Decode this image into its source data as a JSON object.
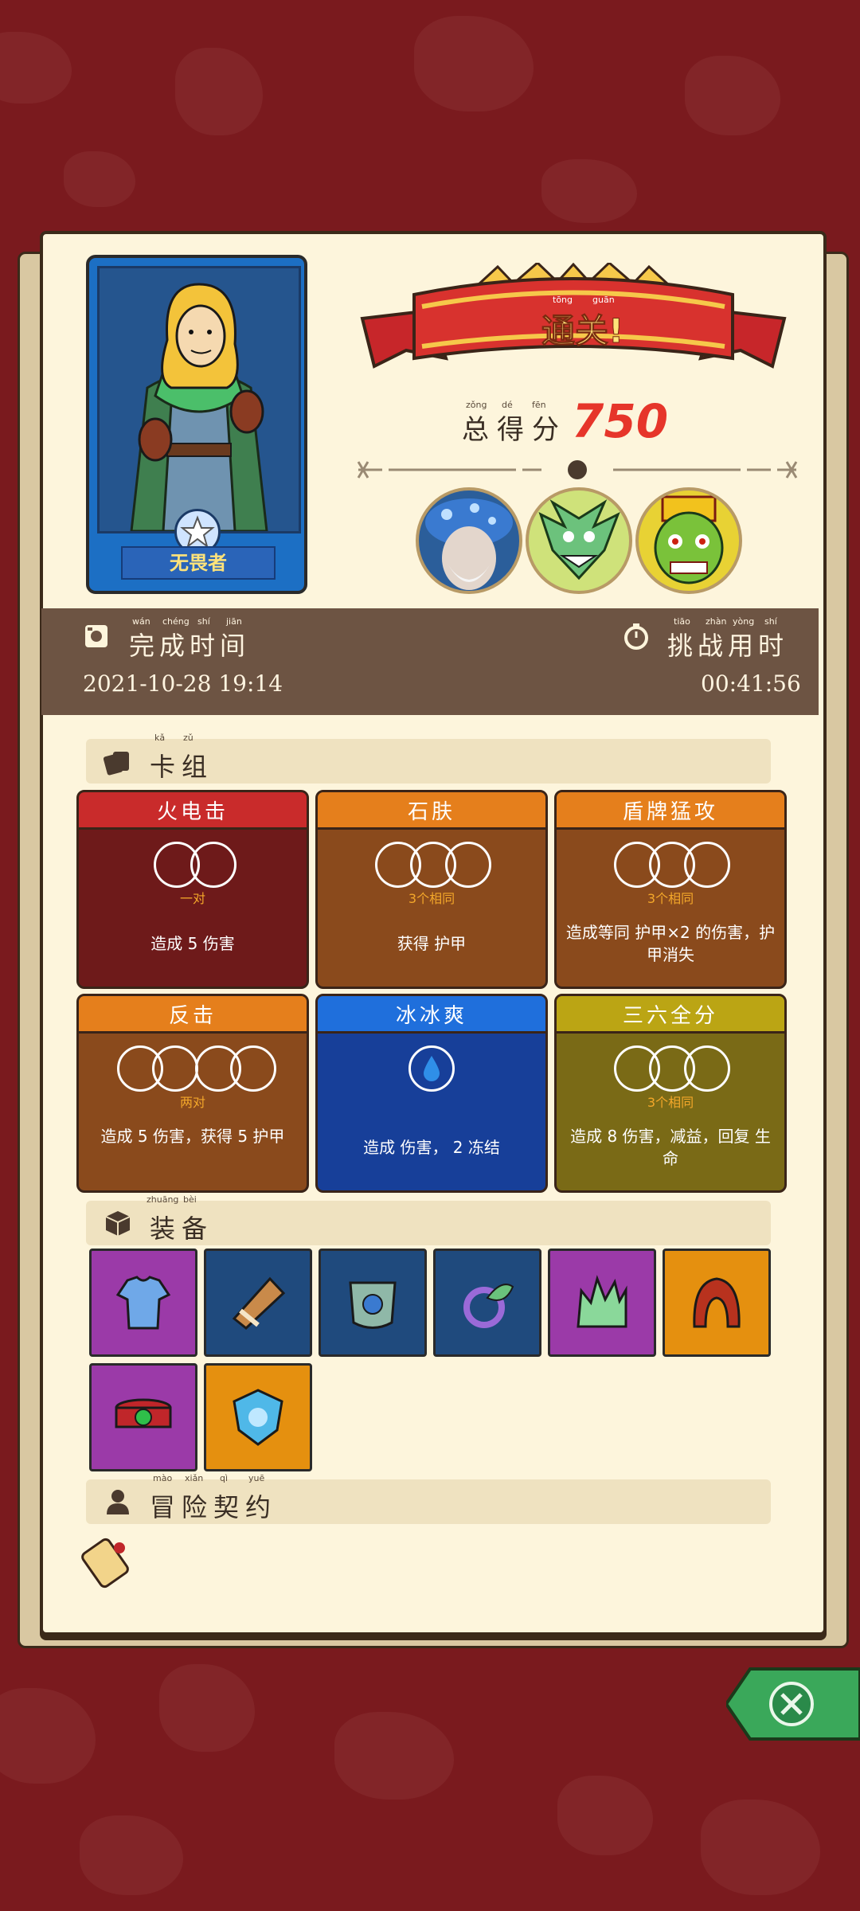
{
  "result": {
    "banner_text": "通关!",
    "banner_pinyin": [
      "tōng",
      "guān"
    ],
    "score_label": "总得分",
    "score_pinyin": [
      "zǒng",
      "dé",
      "fēn"
    ],
    "score_value": "750"
  },
  "hero": {
    "name": "无畏者"
  },
  "bosses": [
    {
      "name": "mushroom-sage-portrait"
    },
    {
      "name": "goblin-shaman-portrait"
    },
    {
      "name": "masked-warrior-portrait"
    }
  ],
  "time": {
    "finish_label": "完成时间",
    "finish_pinyin": [
      "wán",
      "chéng",
      "shí",
      "jiān"
    ],
    "finish_value": "2021-10-28 19:14",
    "challenge_label": "挑战用时",
    "challenge_pinyin": [
      "tiāo",
      "zhàn",
      "yòng",
      "shí"
    ],
    "challenge_value": "00:41:56"
  },
  "sections": {
    "deck": {
      "title": "卡组",
      "pinyin": [
        "kǎ",
        "zǔ"
      ]
    },
    "equipment": {
      "title": "装备",
      "pinyin": [
        "zhuāng",
        "bèi"
      ]
    },
    "contract": {
      "title": "冒险契约",
      "pinyin": [
        "mào",
        "xiǎn",
        "qì",
        "yuē"
      ]
    }
  },
  "cards": [
    {
      "title": "火电击",
      "sub": "一对",
      "desc": "造成 5 伤害",
      "color": "#c92b2b",
      "body": "#6e1a1a",
      "slots": 2
    },
    {
      "title": "石肤",
      "sub": "3个相同",
      "desc": "获得 护甲",
      "color": "#e57f1c",
      "body": "#8a4a1c",
      "slots": 3
    },
    {
      "title": "盾牌猛攻",
      "sub": "3个相同",
      "desc": "造成等同 护甲×2 的伤害，护甲消失",
      "color": "#e57f1c",
      "body": "#8a4a1c",
      "slots": 3
    },
    {
      "title": "反击",
      "sub": "两对",
      "desc": "造成 5 伤害，获得 5 护甲",
      "color": "#e57f1c",
      "body": "#8a4a1c",
      "slots": 4
    },
    {
      "title": "冰冰爽",
      "sub": "",
      "desc": "造成 伤害， 2 冻结",
      "color": "#1f6fdc",
      "body": "#173f99",
      "slots": 1
    },
    {
      "title": "三六全分",
      "sub": "3个相同",
      "desc": "造成 8 伤害，减益，回复 生命",
      "color": "#bba514",
      "body": "#7a6a16",
      "slots": 3
    }
  ],
  "equipment": [
    {
      "icon": "tunic-icon",
      "bg": "#9b3aa8"
    },
    {
      "icon": "horn-icon",
      "bg": "#1f4a7d"
    },
    {
      "icon": "chest-armor-icon",
      "bg": "#1f4a7d"
    },
    {
      "icon": "leaf-ring-icon",
      "bg": "#1f4a7d"
    },
    {
      "icon": "crystal-crown-icon",
      "bg": "#9b3aa8"
    },
    {
      "icon": "hood-icon",
      "bg": "#e5900f"
    },
    {
      "icon": "belt-icon",
      "bg": "#9b3aa8"
    },
    {
      "icon": "shield-gem-icon",
      "bg": "#e5900f"
    }
  ]
}
